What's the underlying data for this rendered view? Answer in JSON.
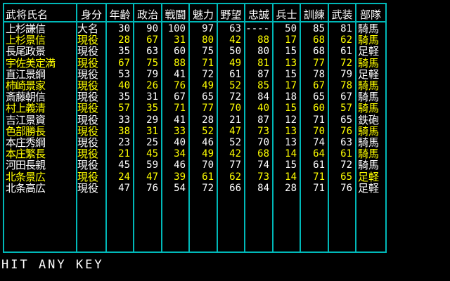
{
  "headers": {
    "name": "武将氏名",
    "status": "身分",
    "age": "年齢",
    "politics": "政治",
    "combat": "戦闘",
    "charisma": "魅力",
    "ambition": "野望",
    "loyalty": "忠誠",
    "soldiers": "兵士",
    "training": "訓練",
    "armament": "武装",
    "unit": "部隊"
  },
  "rows": [
    {
      "name": "上杉謙信",
      "status": "大名",
      "age": "30",
      "politics": "90",
      "combat": "100",
      "charisma": "97",
      "ambition": "63",
      "loyalty": "----",
      "soldiers": "50",
      "training": "85",
      "armament": "81",
      "unit": "騎馬",
      "color": "white"
    },
    {
      "name": "上杉景信",
      "status": "現役",
      "age": "28",
      "politics": "67",
      "combat": "31",
      "charisma": "80",
      "ambition": "42",
      "loyalty": "88",
      "soldiers": "17",
      "training": "68",
      "armament": "62",
      "unit": "騎馬",
      "color": "yellow"
    },
    {
      "name": "長尾政景",
      "status": "現役",
      "age": "35",
      "politics": "63",
      "combat": "60",
      "charisma": "75",
      "ambition": "50",
      "loyalty": "80",
      "soldiers": "15",
      "training": "68",
      "armament": "61",
      "unit": "足軽",
      "color": "white"
    },
    {
      "name": "宇佐美定満",
      "status": "現役",
      "age": "67",
      "politics": "75",
      "combat": "88",
      "charisma": "71",
      "ambition": "49",
      "loyalty": "81",
      "soldiers": "13",
      "training": "77",
      "armament": "72",
      "unit": "騎馬",
      "color": "yellow"
    },
    {
      "name": "直江景綱",
      "status": "現役",
      "age": "53",
      "politics": "79",
      "combat": "41",
      "charisma": "72",
      "ambition": "61",
      "loyalty": "87",
      "soldiers": "15",
      "training": "78",
      "armament": "79",
      "unit": "足軽",
      "color": "white"
    },
    {
      "name": "柿崎景家",
      "status": "現役",
      "age": "40",
      "politics": "26",
      "combat": "76",
      "charisma": "49",
      "ambition": "52",
      "loyalty": "85",
      "soldiers": "17",
      "training": "67",
      "armament": "78",
      "unit": "騎馬",
      "color": "yellow"
    },
    {
      "name": "斎藤朝信",
      "status": "現役",
      "age": "35",
      "politics": "31",
      "combat": "67",
      "charisma": "65",
      "ambition": "72",
      "loyalty": "84",
      "soldiers": "18",
      "training": "65",
      "armament": "67",
      "unit": "騎馬",
      "color": "white"
    },
    {
      "name": "村上義清",
      "status": "現役",
      "age": "57",
      "politics": "35",
      "combat": "71",
      "charisma": "77",
      "ambition": "70",
      "loyalty": "40",
      "soldiers": "15",
      "training": "60",
      "armament": "57",
      "unit": "騎馬",
      "color": "yellow"
    },
    {
      "name": "吉江景資",
      "status": "現役",
      "age": "33",
      "politics": "29",
      "combat": "41",
      "charisma": "28",
      "ambition": "21",
      "loyalty": "87",
      "soldiers": "12",
      "training": "71",
      "armament": "65",
      "unit": "鉄砲",
      "color": "white"
    },
    {
      "name": "色部勝長",
      "status": "現役",
      "age": "38",
      "politics": "31",
      "combat": "33",
      "charisma": "52",
      "ambition": "47",
      "loyalty": "73",
      "soldiers": "13",
      "training": "70",
      "armament": "76",
      "unit": "騎馬",
      "color": "yellow"
    },
    {
      "name": "本庄秀綱",
      "status": "現役",
      "age": "23",
      "politics": "25",
      "combat": "40",
      "charisma": "46",
      "ambition": "52",
      "loyalty": "70",
      "soldiers": "13",
      "training": "74",
      "armament": "63",
      "unit": "騎馬",
      "color": "white"
    },
    {
      "name": "本庄繁長",
      "status": "現役",
      "age": "21",
      "politics": "45",
      "combat": "34",
      "charisma": "49",
      "ambition": "42",
      "loyalty": "68",
      "soldiers": "14",
      "training": "64",
      "armament": "61",
      "unit": "騎馬",
      "color": "yellow"
    },
    {
      "name": "河田長親",
      "status": "現役",
      "age": "45",
      "politics": "59",
      "combat": "46",
      "charisma": "70",
      "ambition": "77",
      "loyalty": "74",
      "soldiers": "15",
      "training": "61",
      "armament": "72",
      "unit": "騎馬",
      "color": "white"
    },
    {
      "name": "北条景広",
      "status": "現役",
      "age": "24",
      "politics": "47",
      "combat": "39",
      "charisma": "61",
      "ambition": "62",
      "loyalty": "73",
      "soldiers": "14",
      "training": "71",
      "armament": "65",
      "unit": "足軽",
      "color": "yellow"
    },
    {
      "name": "北条高広",
      "status": "現役",
      "age": "47",
      "politics": "76",
      "combat": "54",
      "charisma": "72",
      "ambition": "66",
      "loyalty": "84",
      "soldiers": "28",
      "training": "71",
      "armament": "76",
      "unit": "足軽",
      "color": "white"
    }
  ],
  "prompt": "HIT ANY KEY",
  "colors": {
    "border": "#00b8b8",
    "text": "#ffffff",
    "highlight": "#ffff00",
    "background": "#000000"
  }
}
